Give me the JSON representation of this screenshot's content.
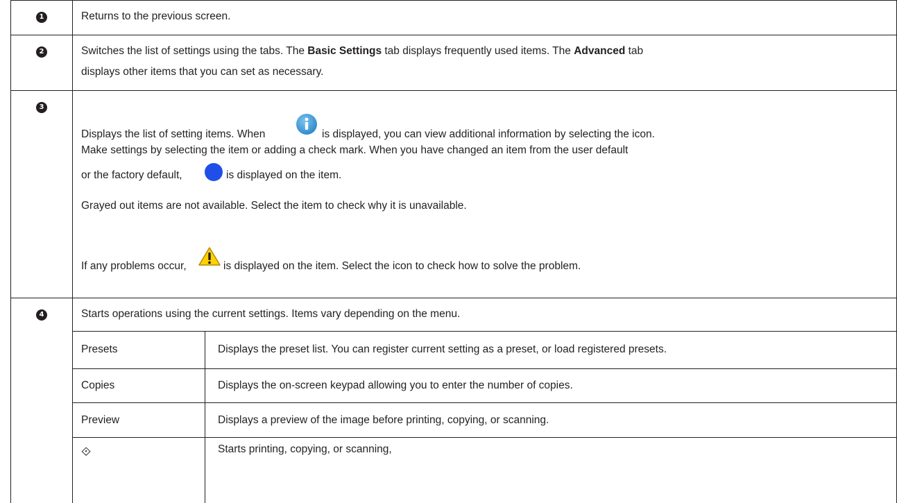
{
  "rows": [
    {
      "badge": "1",
      "text": "Returns to the previous screen."
    },
    {
      "badge": "2",
      "line1_pre": "Switches the list of settings using the tabs. The ",
      "line1_bold1": "Basic Settings",
      "line1_mid": " tab displays frequently used items. The ",
      "line1_bold2": "Advanced",
      "line1_post": " tab",
      "line2": "displays other items that you can set as necessary."
    },
    {
      "badge": "3",
      "p1_pre": "Displays the list of setting items. When ",
      "p1_post": " is displayed, you can view additional information by selecting the icon.",
      "p1_line2": "Make settings by selecting the item or adding a check mark. When you have changed an item from the user default",
      "p1_line3_pre": "or the factory default, ",
      "p1_line3_post": " is displayed on the item.",
      "p2": "Grayed out items are not available. Select the item to check why it is unavailable.",
      "p3_pre": "If any problems occur, ",
      "p3_post": " is displayed on the item. Select the icon to check how to solve the problem."
    },
    {
      "badge": "4",
      "text": "Starts operations using the current settings. Items vary depending on the menu.",
      "sub": [
        {
          "label": "Presets",
          "desc": "Displays the preset list. You can register current setting as a preset, or load registered presets."
        },
        {
          "label": "Copies",
          "desc": "Displays the on-screen keypad allowing you to enter the number of copies."
        },
        {
          "label": "Preview",
          "desc": "Displays a preview of the image before printing, copying, or scanning."
        },
        {
          "label": "⟐",
          "desc": "Starts printing, copying, or scanning,"
        }
      ]
    }
  ],
  "icons": {
    "info": "info-icon",
    "changed_marker": "blue-dot-icon",
    "warning": "warning-icon",
    "start": "start-diamond-icon"
  },
  "colors": {
    "info_blue": "#3a9ad9",
    "changed_blue": "#1f4fe8",
    "warning_yellow": "#ffd200"
  }
}
